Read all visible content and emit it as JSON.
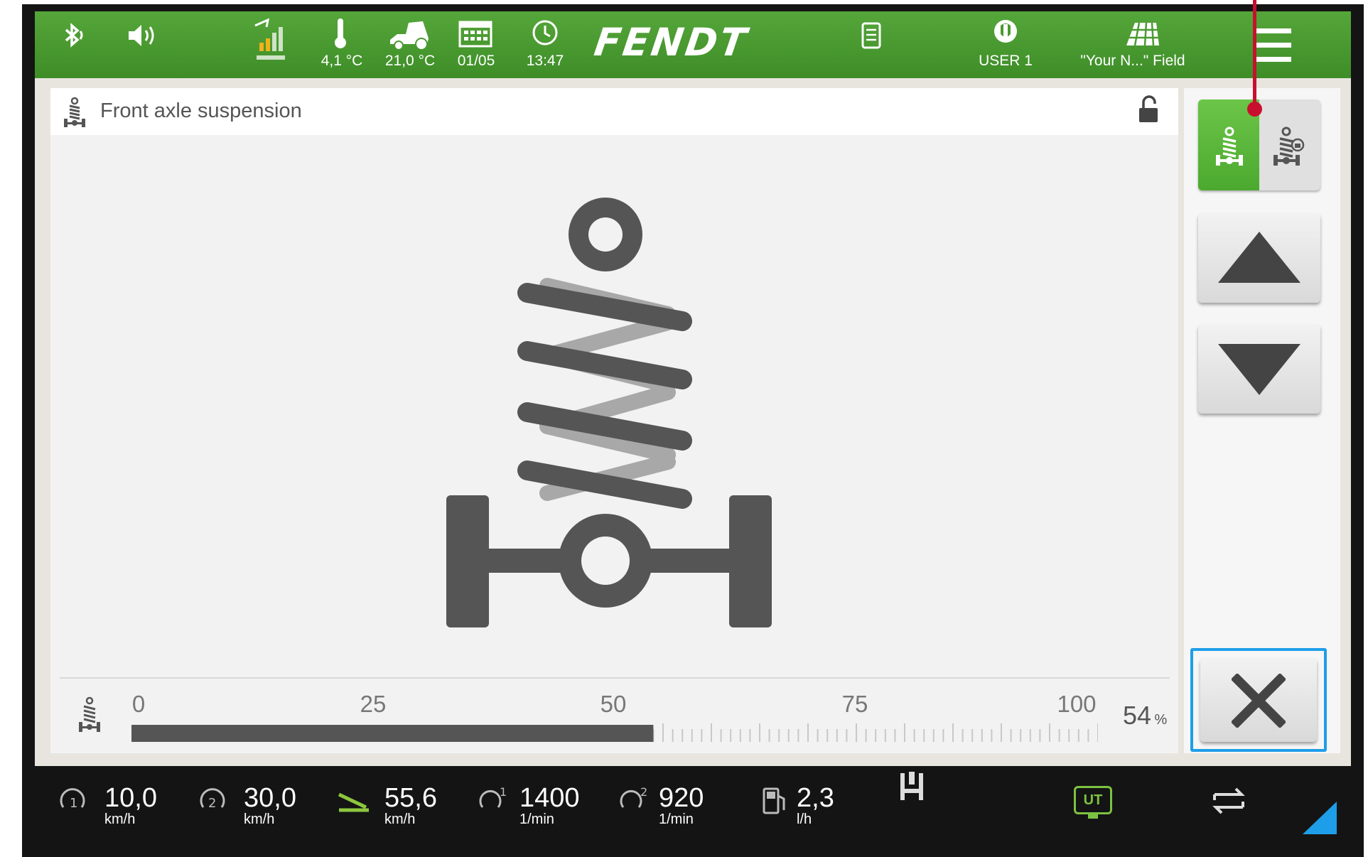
{
  "topbar": {
    "temperature_outside": "4,1 °C",
    "temperature_cab": "21,0 °C",
    "date": "01/05",
    "time": "13:47",
    "brand": "FENDT",
    "user": "USER 1",
    "field": "\"Your N...\" Field"
  },
  "panel": {
    "title": "Front axle suspension",
    "lock_state": "unlocked"
  },
  "slider": {
    "tick_labels": [
      "0",
      "25",
      "50",
      "75",
      "100"
    ],
    "value_percent": 54,
    "value_text": "54",
    "unit": "%"
  },
  "bottombar": {
    "items": [
      {
        "value": "10,0",
        "unit": "km/h",
        "icon": "cruise-speed-1-icon"
      },
      {
        "value": "30,0",
        "unit": "km/h",
        "icon": "cruise-speed-2-icon"
      },
      {
        "value": "55,6",
        "unit": "km/h",
        "icon": "ground-speed-icon"
      },
      {
        "value": "1400",
        "unit": "1/min",
        "icon": "engine-speed-1-icon"
      },
      {
        "value": "920",
        "unit": "1/min",
        "icon": "engine-speed-2-icon"
      },
      {
        "value": "2,3",
        "unit": "l/h",
        "icon": "fuel-consumption-icon"
      }
    ],
    "ut_label": "UT"
  },
  "colors": {
    "topbar_green": "#4a9a32",
    "active_green": "#5cb83a",
    "close_border": "#1e9ee8",
    "annotation_red": "#c8102e",
    "icon_gray": "#555555"
  }
}
